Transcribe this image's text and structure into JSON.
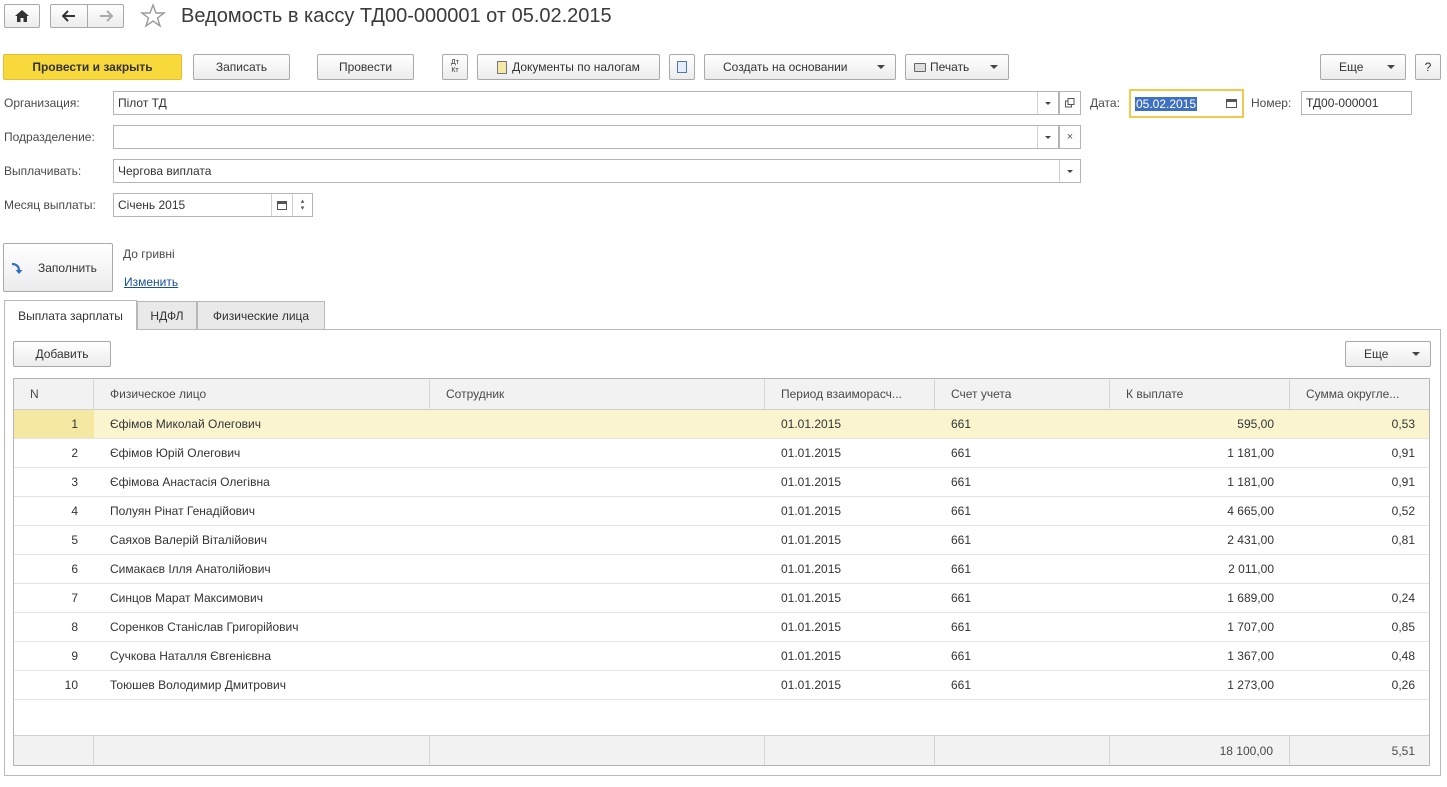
{
  "header": {
    "title": "Ведомость в кассу ТД00-000001 от 05.02.2015"
  },
  "toolbar": {
    "post_close": "Провести и закрыть",
    "save": "Записать",
    "post": "Провести",
    "dt_kt": "Дт Кт",
    "tax_docs": "Документы по налогам",
    "create_based": "Создать на основании",
    "print": "Печать",
    "more": "Еще",
    "help": "?"
  },
  "form": {
    "org_label": "Организация:",
    "org_value": "Пілот ТД",
    "dept_label": "Подразделение:",
    "dept_value": "",
    "pay_label": "Выплачивать:",
    "pay_value": "Чергова виплата",
    "month_label": "Месяц выплаты:",
    "month_value": "Січень 2015",
    "date_label": "Дата:",
    "date_value": "05.02.2015",
    "number_label": "Номер:",
    "number_value": "ТД00-000001"
  },
  "fill": {
    "button": "Заполнить",
    "rounding_text": "До гривні",
    "change_link": "Изменить"
  },
  "tabs": [
    "Выплата зарплаты",
    "НДФЛ",
    "Физические лица"
  ],
  "grid_toolbar": {
    "add": "Добавить",
    "more": "Еще"
  },
  "table": {
    "columns": [
      "N",
      "Физическое лицо",
      "Сотрудник",
      "Период взаиморасч...",
      "Счет учета",
      "К выплате",
      "Сумма округле..."
    ],
    "rows": [
      {
        "n": "1",
        "person": "Єфімов Миколай Олегович",
        "employee": "",
        "period": "01.01.2015",
        "account": "661",
        "amount": "595,00",
        "rounding": "0,53"
      },
      {
        "n": "2",
        "person": "Єфімов Юрій Олегович",
        "employee": "",
        "period": "01.01.2015",
        "account": "661",
        "amount": "1 181,00",
        "rounding": "0,91"
      },
      {
        "n": "3",
        "person": "Єфімова Анастасія Олегівна",
        "employee": "",
        "period": "01.01.2015",
        "account": "661",
        "amount": "1 181,00",
        "rounding": "0,91"
      },
      {
        "n": "4",
        "person": "Полуян Рінат Генадійович",
        "employee": "",
        "period": "01.01.2015",
        "account": "661",
        "amount": "4 665,00",
        "rounding": "0,52"
      },
      {
        "n": "5",
        "person": "Саяхов Валерій Віталійович",
        "employee": "",
        "period": "01.01.2015",
        "account": "661",
        "amount": "2 431,00",
        "rounding": "0,81"
      },
      {
        "n": "6",
        "person": "Симакаєв Ілля Анатолійович",
        "employee": "",
        "period": "01.01.2015",
        "account": "661",
        "amount": "2 011,00",
        "rounding": ""
      },
      {
        "n": "7",
        "person": "Синцов Марат Максимович",
        "employee": "",
        "period": "01.01.2015",
        "account": "661",
        "amount": "1 689,00",
        "rounding": "0,24"
      },
      {
        "n": "8",
        "person": "Соренков Станіслав Григорійович",
        "employee": "",
        "period": "01.01.2015",
        "account": "661",
        "amount": "1 707,00",
        "rounding": "0,85"
      },
      {
        "n": "9",
        "person": "Сучкова Наталля Євгенієвна",
        "employee": "",
        "period": "01.01.2015",
        "account": "661",
        "amount": "1 367,00",
        "rounding": "0,48"
      },
      {
        "n": "10",
        "person": "Тоюшев Володимир Дмитрович",
        "employee": "",
        "period": "01.01.2015",
        "account": "661",
        "amount": "1 273,00",
        "rounding": "0,26"
      }
    ],
    "totals": {
      "amount": "18 100,00",
      "rounding": "5,51"
    }
  },
  "colors": {
    "primary_button": "#f7d93b",
    "selected_row": "#fbf5cf",
    "date_focus": "#f2c94c",
    "link": "#1a4f9c"
  }
}
